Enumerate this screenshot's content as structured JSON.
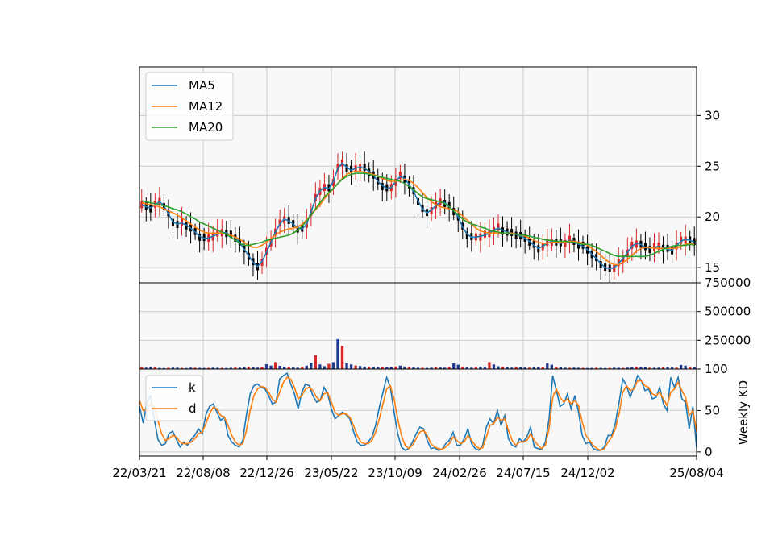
{
  "chart_data": [
    {
      "type": "candlestick",
      "panel": "price",
      "y_ticks": [
        "15",
        "20",
        "25",
        "30"
      ],
      "ylim": [
        13.5,
        34.8
      ],
      "grid": true,
      "legend_position": "top-left",
      "colors": {
        "up": "#d62728",
        "down": "#000000",
        "ma5": "#1f77b4",
        "ma12": "#ff7f0e",
        "ma20": "#2ca02c",
        "background": "#f8f8f8",
        "grid": "#cccccc"
      },
      "series": [
        {
          "name": "MA5",
          "values": [
            21.2,
            21.0,
            20.9,
            21.2,
            21.5,
            21.1,
            20.3,
            19.5,
            19.3,
            19.4,
            19.2,
            18.9,
            18.5,
            18.1,
            17.9,
            17.9,
            18.1,
            18.3,
            18.5,
            18.4,
            18.2,
            18.0,
            17.5,
            16.8,
            16.2,
            15.5,
            15.1,
            15.6,
            16.5,
            17.5,
            18.5,
            19.3,
            19.8,
            19.6,
            19.3,
            18.9,
            18.8,
            19.3,
            20.5,
            21.8,
            22.6,
            22.9,
            22.8,
            23.5,
            24.8,
            25.3,
            24.9,
            24.6,
            24.8,
            24.9,
            24.8,
            24.5,
            24.1,
            23.5,
            23.1,
            22.8,
            22.9,
            23.5,
            24.0,
            23.8,
            23.2,
            22.5,
            21.6,
            20.8,
            20.4,
            20.7,
            21.1,
            21.5,
            21.4,
            21.0,
            20.6,
            20.0,
            19.0,
            18.3,
            18.0,
            18.0,
            18.1,
            18.2,
            18.4,
            18.7,
            18.9,
            18.7,
            18.5,
            18.4,
            18.3,
            18.1,
            17.9,
            17.6,
            17.2,
            16.9,
            17.1,
            17.4,
            17.6,
            17.5,
            17.4,
            17.5,
            17.7,
            17.6,
            17.3,
            17.1,
            16.8,
            16.3,
            15.9,
            15.4,
            15.0,
            14.9,
            15.0,
            15.4,
            15.9,
            16.5,
            17.1,
            17.4,
            17.3,
            17.0,
            16.9,
            17.0,
            17.1,
            17.0,
            16.8,
            16.7,
            17.2,
            17.6,
            17.8,
            17.7,
            17.5
          ]
        },
        {
          "name": "MA12",
          "values": [
            21.4,
            21.3,
            21.2,
            21.1,
            21.0,
            20.8,
            20.6,
            20.4,
            20.2,
            19.9,
            19.6,
            19.3,
            19.0,
            18.7,
            18.5,
            18.4,
            18.4,
            18.4,
            18.4,
            18.3,
            18.2,
            18.0,
            17.8,
            17.5,
            17.2,
            17.0,
            17.0,
            17.2,
            17.5,
            17.9,
            18.2,
            18.5,
            18.7,
            18.8,
            18.9,
            19.0,
            19.3,
            19.7,
            20.2,
            20.7,
            21.2,
            21.8,
            22.3,
            22.8,
            23.3,
            23.8,
            24.2,
            24.4,
            24.5,
            24.5,
            24.4,
            24.3,
            24.2,
            24.0,
            23.8,
            23.6,
            23.5,
            23.5,
            23.6,
            23.7,
            23.6,
            23.3,
            22.9,
            22.4,
            21.9,
            21.5,
            21.2,
            21.0,
            20.9,
            20.8,
            20.7,
            20.5,
            20.1,
            19.7,
            19.3,
            18.9,
            18.6,
            18.5,
            18.4,
            18.4,
            18.4,
            18.4,
            18.4,
            18.4,
            18.3,
            18.2,
            18.1,
            17.9,
            17.7,
            17.5,
            17.4,
            17.4,
            17.5,
            17.5,
            17.5,
            17.5,
            17.6,
            17.6,
            17.5,
            17.4,
            17.2,
            16.9,
            16.6,
            16.2,
            15.8,
            15.5,
            15.3,
            15.3,
            15.5,
            15.8,
            16.2,
            16.6,
            16.9,
            17.0,
            17.0,
            16.9,
            16.9,
            16.9,
            16.9,
            16.9,
            16.9,
            17.1,
            17.3,
            17.4,
            17.3
          ]
        },
        {
          "name": "MA20",
          "values": [
            21.6,
            21.5,
            21.4,
            21.3,
            21.2,
            21.1,
            21.0,
            20.8,
            20.7,
            20.5,
            20.3,
            20.0,
            19.8,
            19.5,
            19.3,
            19.1,
            18.9,
            18.7,
            18.5,
            18.3,
            18.0,
            17.7,
            17.4,
            17.2,
            17.2,
            17.3,
            17.4,
            17.5,
            17.7,
            17.8,
            17.9,
            18.0,
            18.1,
            18.2,
            18.4,
            18.7,
            19.1,
            19.6,
            20.2,
            20.8,
            21.4,
            22.0,
            22.4,
            22.8,
            23.3,
            23.7,
            24.0,
            24.2,
            24.3,
            24.3,
            24.3,
            24.2,
            24.1,
            24.0,
            23.9,
            23.8,
            23.7,
            23.6,
            23.5,
            23.3,
            23.0,
            22.7,
            22.3,
            22.0,
            21.8,
            21.7,
            21.6,
            21.5,
            21.3,
            21.0,
            20.6,
            20.2,
            19.8,
            19.5,
            19.3,
            19.2,
            19.0,
            18.9,
            18.7,
            18.6,
            18.5,
            18.4,
            18.4,
            18.3,
            18.3,
            18.2,
            18.2,
            18.1,
            18.0,
            17.9,
            17.8,
            17.7,
            17.7,
            17.6,
            17.6,
            17.6,
            17.5,
            17.5,
            17.4,
            17.3,
            17.3,
            17.2,
            17.0,
            16.8,
            16.6,
            16.4,
            16.2,
            16.1,
            16.1,
            16.1,
            16.1,
            16.1,
            16.1,
            16.1,
            16.2,
            16.4,
            16.6,
            16.8,
            17.0,
            17.1,
            17.2,
            17.2,
            17.2,
            17.3,
            17.2
          ]
        }
      ],
      "candles_note": "weekly OHLC, red = up week, black = down week"
    },
    {
      "type": "bar",
      "panel": "volume",
      "y_ticks": [
        "250000",
        "500000",
        "750000"
      ],
      "ylim": [
        0,
        750000
      ],
      "grid": true,
      "colors": {
        "up": "#d62728",
        "down": "#1f3a93",
        "background": "#f8f8f8"
      },
      "values": [
        15000,
        12000,
        18000,
        14000,
        10000,
        9000,
        11000,
        13000,
        12000,
        10000,
        9000,
        12000,
        11000,
        10000,
        9000,
        10000,
        12000,
        11000,
        10000,
        9000,
        11000,
        13000,
        12000,
        16000,
        20000,
        14000,
        12000,
        14000,
        42000,
        30000,
        60000,
        28000,
        20000,
        18000,
        14000,
        12000,
        20000,
        30000,
        55000,
        120000,
        40000,
        25000,
        45000,
        60000,
        260000,
        200000,
        50000,
        40000,
        30000,
        26000,
        22000,
        20000,
        18000,
        16000,
        15000,
        14000,
        16000,
        22000,
        30000,
        22000,
        16000,
        14000,
        12000,
        11000,
        10000,
        12000,
        14000,
        13000,
        12000,
        16000,
        50000,
        38000,
        20000,
        14000,
        12000,
        18000,
        22000,
        20000,
        60000,
        40000,
        24000,
        18000,
        14000,
        12000,
        16000,
        14000,
        13000,
        12000,
        20000,
        15000,
        14000,
        50000,
        38000,
        16000,
        14000,
        12000,
        11000,
        12000,
        11000,
        10000,
        9000,
        10000,
        11000,
        10000,
        9000,
        10000,
        12000,
        11000,
        10000,
        12000,
        14000,
        18000,
        16000,
        14000,
        12000,
        11000,
        12000,
        14000,
        20000,
        16000,
        12000,
        36000,
        30000,
        16000,
        14000
      ]
    },
    {
      "type": "line",
      "panel": "kd",
      "ylabel": "Weekly KD",
      "y_ticks": [
        "0",
        "50",
        "100"
      ],
      "ylim": [
        -5,
        100
      ],
      "grid": true,
      "legend_position": "top-left",
      "x_ticks": [
        "22/03/21",
        "22/08/08",
        "22/12/26",
        "23/05/22",
        "23/10/09",
        "24/02/26",
        "24/07/15",
        "24/12/02",
        "25/08/04"
      ],
      "series": [
        {
          "name": "k",
          "values": [
            55,
            35,
            60,
            68,
            40,
            15,
            8,
            10,
            22,
            25,
            15,
            6,
            12,
            8,
            15,
            20,
            28,
            22,
            45,
            55,
            58,
            48,
            38,
            42,
            20,
            12,
            8,
            6,
            14,
            45,
            70,
            80,
            82,
            78,
            76,
            68,
            58,
            60,
            88,
            92,
            95,
            82,
            70,
            52,
            72,
            82,
            80,
            68,
            60,
            62,
            78,
            70,
            52,
            40,
            44,
            48,
            45,
            40,
            25,
            12,
            8,
            8,
            12,
            18,
            32,
            54,
            72,
            90,
            78,
            48,
            22,
            6,
            2,
            4,
            12,
            22,
            30,
            28,
            14,
            4,
            5,
            2,
            3,
            10,
            14,
            24,
            8,
            8,
            16,
            28,
            10,
            4,
            2,
            8,
            30,
            40,
            34,
            50,
            32,
            44,
            16,
            8,
            6,
            16,
            12,
            18,
            30,
            6,
            4,
            3,
            12,
            40,
            92,
            74,
            55,
            58,
            70,
            52,
            68,
            48,
            20,
            10,
            12,
            4,
            2,
            2,
            6,
            20,
            20,
            35,
            60,
            88,
            80,
            66,
            78,
            92,
            86,
            74,
            76,
            64,
            66,
            78,
            58,
            50,
            90,
            78,
            90,
            64,
            60,
            28,
            55,
            5
          ]
        },
        {
          "name": "d",
          "values": [
            62,
            50,
            52,
            58,
            55,
            38,
            22,
            14,
            16,
            20,
            18,
            12,
            10,
            10,
            12,
            16,
            22,
            24,
            34,
            46,
            54,
            52,
            44,
            42,
            32,
            20,
            12,
            8,
            10,
            26,
            50,
            68,
            76,
            79,
            78,
            72,
            64,
            60,
            72,
            84,
            90,
            88,
            78,
            64,
            68,
            76,
            78,
            74,
            66,
            62,
            70,
            72,
            60,
            48,
            44,
            46,
            46,
            42,
            32,
            20,
            12,
            10,
            10,
            14,
            24,
            40,
            58,
            76,
            80,
            64,
            40,
            20,
            8,
            4,
            8,
            16,
            24,
            26,
            20,
            10,
            6,
            4,
            3,
            6,
            10,
            18,
            14,
            10,
            12,
            20,
            14,
            8,
            4,
            5,
            18,
            32,
            34,
            42,
            38,
            40,
            26,
            14,
            8,
            12,
            12,
            14,
            22,
            14,
            8,
            4,
            8,
            28,
            66,
            76,
            66,
            60,
            64,
            58,
            62,
            56,
            36,
            20,
            14,
            8,
            4,
            2,
            4,
            12,
            18,
            28,
            46,
            72,
            80,
            74,
            76,
            86,
            86,
            80,
            78,
            70,
            68,
            72,
            64,
            56,
            72,
            76,
            84,
            74,
            66,
            44,
            50,
            25
          ]
        }
      ]
    }
  ]
}
